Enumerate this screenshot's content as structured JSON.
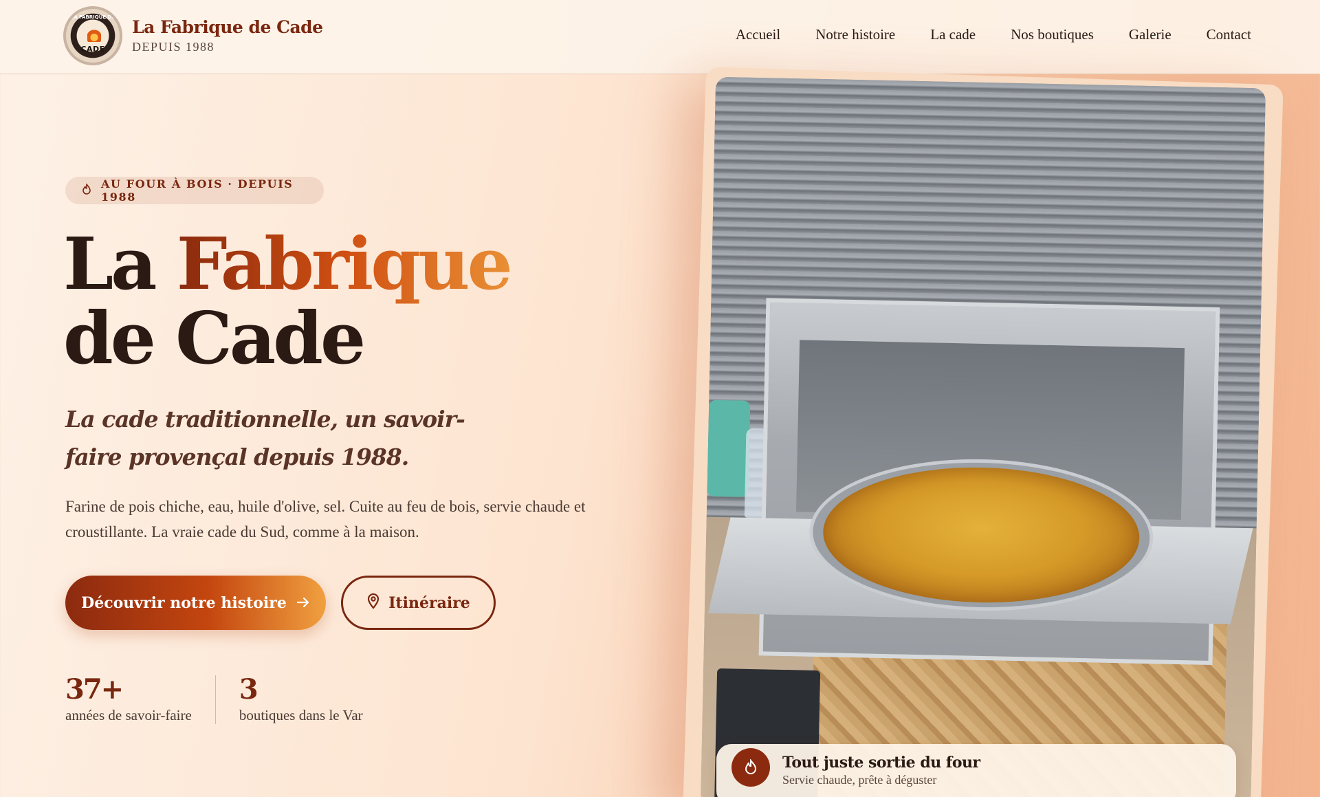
{
  "brand": {
    "title": "La Fabrique de Cade",
    "subtitle": "DEPUIS 1988",
    "logo_top": "LA FABRIQUE DE",
    "logo_bottom": "CADE"
  },
  "nav": {
    "items": [
      {
        "label": "Accueil"
      },
      {
        "label": "Notre histoire"
      },
      {
        "label": "La cade"
      },
      {
        "label": "Nos boutiques"
      },
      {
        "label": "Galerie"
      },
      {
        "label": "Contact"
      }
    ]
  },
  "hero": {
    "badge": "AU FOUR À BOIS · DEPUIS 1988",
    "title_part1": "La ",
    "title_highlight": "Fabrique",
    "title_line2": "de Cade",
    "tagline_line1": "La cade traditionnelle, un savoir-",
    "tagline_line2": "faire provençal depuis 1988.",
    "description": "Farine de pois chiche, eau, huile d'olive, sel. Cuite au feu de bois, servie chaude et croustillante. La vraie cade du Sud, comme à la maison.",
    "primary_button": "Découvrir notre histoire",
    "primary_icon": "arrow-right-icon",
    "secondary_button": "Itinéraire",
    "secondary_icon": "map-pin-icon"
  },
  "stats": [
    {
      "value": "37+",
      "label": "années de savoir-faire"
    },
    {
      "value": "3",
      "label": "boutiques dans le Var"
    }
  ],
  "caption": {
    "title": "Tout juste sortie du four",
    "subtitle": "Servie chaude, prête à déguster",
    "icon": "flame-icon"
  },
  "colors": {
    "brand": "#7a2710",
    "accent_start": "#8c2a0f",
    "accent_end": "#f0a040",
    "text": "#2b1a14"
  }
}
